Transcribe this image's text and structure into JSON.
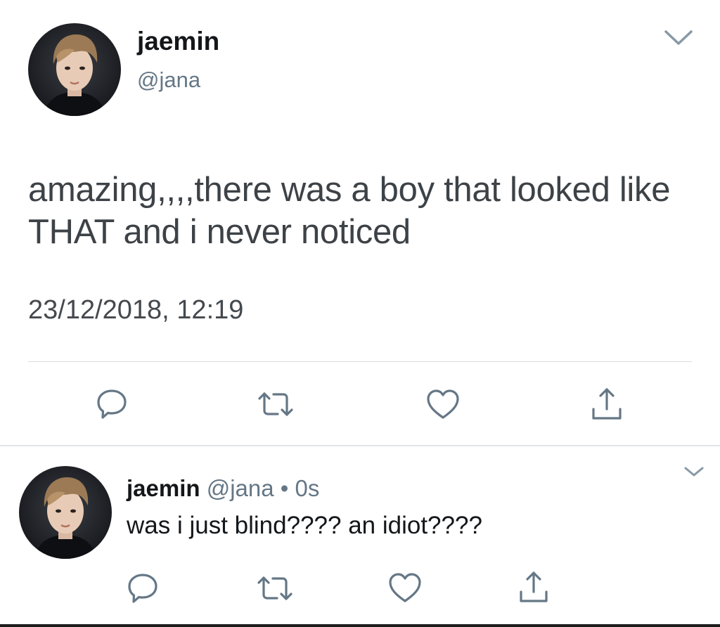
{
  "main_tweet": {
    "display_name": "jaemin",
    "handle": "@jana",
    "text": "amazing,,,,there was a boy that looked like THAT and i never noticed",
    "timestamp": "23/12/2018, 12:19"
  },
  "reply_tweet": {
    "display_name": "jaemin",
    "handle": "@jana",
    "separator": "•",
    "time": "0s",
    "text": "was i just blind???? an idiot????"
  },
  "icons": {
    "reply": "reply-bubble-icon",
    "retweet": "retweet-icon",
    "like": "heart-icon",
    "share": "share-upload-icon",
    "menu": "chevron-down-icon"
  },
  "colors": {
    "text_primary": "#14171a",
    "text_secondary": "#657786",
    "icon": "#657786",
    "divider": "#d7dce0"
  }
}
